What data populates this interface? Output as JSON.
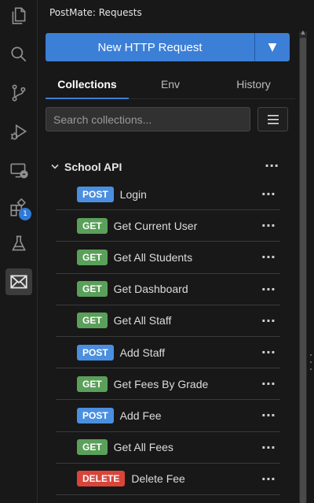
{
  "activity_bar": {
    "items": [
      {
        "icon": "files-icon"
      },
      {
        "icon": "search-icon"
      },
      {
        "icon": "source-control-icon"
      },
      {
        "icon": "run-debug-icon"
      },
      {
        "icon": "remote-explorer-icon"
      },
      {
        "icon": "extensions-icon",
        "badge": "1"
      },
      {
        "icon": "testing-flask-icon"
      },
      {
        "icon": "postmate-mail-icon",
        "active": true
      }
    ]
  },
  "panel": {
    "title": "PostMate: Requests",
    "new_request_label": "New HTTP Request",
    "dropdown_glyph": "▼",
    "tabs": [
      {
        "label": "Collections",
        "active": true
      },
      {
        "label": "Env",
        "active": false
      },
      {
        "label": "History",
        "active": false
      }
    ],
    "search": {
      "placeholder": "Search collections...",
      "value": ""
    },
    "collection": {
      "name": "School API",
      "more_glyph": "···",
      "requests": [
        {
          "method": "POST",
          "name": "Login"
        },
        {
          "method": "GET",
          "name": "Get Current User"
        },
        {
          "method": "GET",
          "name": "Get All Students"
        },
        {
          "method": "GET",
          "name": "Get Dashboard"
        },
        {
          "method": "GET",
          "name": "Get All Staff"
        },
        {
          "method": "POST",
          "name": "Add Staff"
        },
        {
          "method": "GET",
          "name": "Get Fees By Grade"
        },
        {
          "method": "POST",
          "name": "Add Fee"
        },
        {
          "method": "GET",
          "name": "Get All Fees"
        },
        {
          "method": "DELETE",
          "name": "Delete Fee"
        }
      ]
    }
  },
  "colors": {
    "GET": "#5aa05a",
    "POST": "#4a8fe0",
    "DELETE": "#d9453a",
    "accent": "#3c7fd6"
  }
}
